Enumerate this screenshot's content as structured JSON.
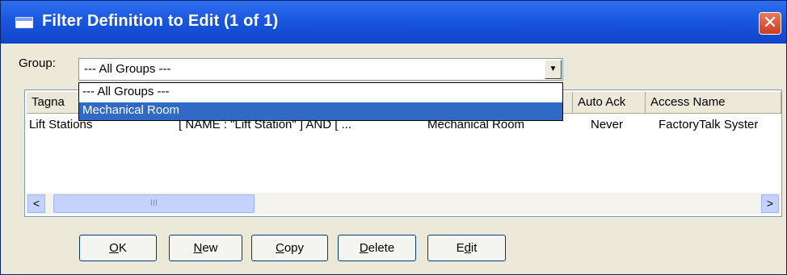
{
  "window": {
    "title": "Filter Definition to Edit (1 of 1)",
    "icon": "window-icon",
    "close_icon": "close-icon",
    "colors": {
      "titlebar": "#1a57e0",
      "selection": "#316ac5",
      "face": "#ece9d8"
    }
  },
  "group": {
    "label": "Group:",
    "value": "--- All Groups ---",
    "options": [
      "--- All Groups ---",
      "Mechanical Room"
    ],
    "selected_index": 1
  },
  "table": {
    "columns": [
      "Tagna",
      "Auto Ack",
      "Access Name"
    ],
    "rows": [
      {
        "tagname": "Lift Stations",
        "filter": "[ NAME : \"Lift Station\" ] AND [ ...",
        "group": "Mechanical Room",
        "auto_ack": "Never",
        "access": "FactoryTalk Syster"
      }
    ],
    "scrollbar": {
      "left_arrow": "<",
      "right_arrow": ">",
      "thumb_grip": "III"
    }
  },
  "buttons": {
    "ok": {
      "underline": "O",
      "rest": "K"
    },
    "new": {
      "underline": "N",
      "rest": "ew"
    },
    "copy": {
      "underline": "C",
      "rest": "opy"
    },
    "delete": {
      "underline": "D",
      "rest": "elete"
    },
    "edit": {
      "first": "E",
      "underline": "d",
      "rest": "it"
    }
  }
}
